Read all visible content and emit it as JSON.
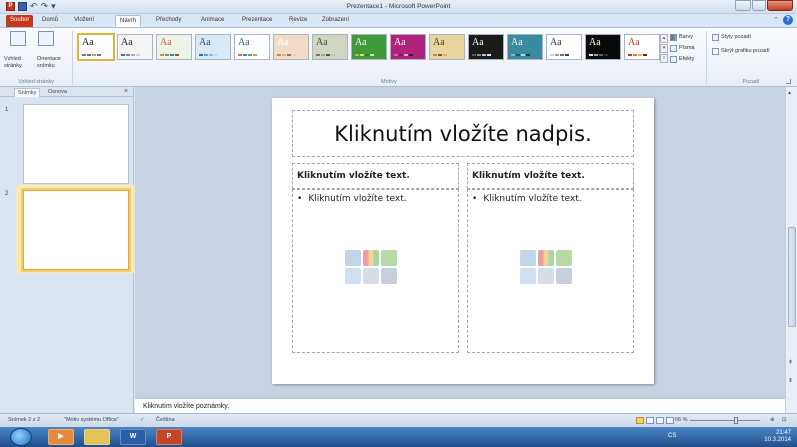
{
  "window": {
    "title": "Prezentace1 - Microsoft PowerPoint",
    "qat_app": "P"
  },
  "tabs": {
    "file": "Soubor",
    "items": [
      "Domů",
      "Vložení",
      "Návrh",
      "Přechody",
      "Animace",
      "Prezentace",
      "Revize",
      "Zobrazení"
    ],
    "active": "Návrh"
  },
  "ribbon": {
    "page_setup": {
      "layout_label": "Vzhled stránky",
      "orientation_label": "Orientace snímku",
      "group_label": "Vzhled stránky"
    },
    "themes": {
      "group_label": "Motivy",
      "items": [
        {
          "label": "Aa",
          "bg": "#ffffff",
          "fg": "#222222",
          "bars": [
            "#4f81bd",
            "#c0504d",
            "#9bbb59",
            "#8064a2"
          ],
          "selected": true
        },
        {
          "label": "Aa",
          "bg": "#f4f4f4",
          "fg": "#222222",
          "bars": [
            "#5c6b7a",
            "#7a8a9b",
            "#a3b1c0",
            "#ccd4dd"
          ],
          "selected": false
        },
        {
          "label": "Aa",
          "bg": "#eef3e8",
          "fg": "#c46a2a",
          "bars": [
            "#d5893a",
            "#7a9a3a",
            "#4a7aa0",
            "#a04a4a"
          ],
          "selected": false
        },
        {
          "label": "Aa",
          "bg": "#dbe9f6",
          "fg": "#1f4f8c",
          "bars": [
            "#2f6db1",
            "#5aa0d8",
            "#89c0e8",
            "#c3dcf0"
          ],
          "selected": false
        },
        {
          "label": "Aa",
          "bg": "#ffffff",
          "fg": "#2a5d8a",
          "bars": [
            "#e06a2a",
            "#2a8ad0",
            "#6aa83a",
            "#d0a02a"
          ],
          "selected": false
        },
        {
          "label": "Aa",
          "bg": "#f3dcc6",
          "fg": "#ffffff",
          "bars": [
            "#d08a5a",
            "#e0b08a",
            "#b06a3a",
            "#f0d0b0"
          ],
          "selected": false
        },
        {
          "label": "Aa",
          "bg": "#cfd6c4",
          "fg": "#3a4a2a",
          "bars": [
            "#6a7a4a",
            "#9aa87a",
            "#4a5a3a",
            "#c0c8aa"
          ],
          "selected": false
        },
        {
          "label": "Aa",
          "bg": "#3f9a3a",
          "fg": "#ffffff",
          "bars": [
            "#9ac83a",
            "#e8e03a",
            "#3a7a2a",
            "#d0e8a0"
          ],
          "selected": false
        },
        {
          "label": "Aa",
          "bg": "#b0237a",
          "fg": "#ffffff",
          "bars": [
            "#e05aa8",
            "#7a1a5a",
            "#f0a0d0",
            "#4a0a3a"
          ],
          "selected": false
        },
        {
          "label": "Aa",
          "bg": "#e8d6a2",
          "fg": "#5a3a0a",
          "bars": [
            "#c08a2a",
            "#8a5a1a",
            "#e0b060",
            "#f0d8a0"
          ],
          "selected": false
        },
        {
          "label": "Aa",
          "bg": "#1a1a1a",
          "fg": "#ffffff",
          "bars": [
            "#5a5a5a",
            "#8a8a8a",
            "#c0c0c0",
            "#e0e0e0"
          ],
          "selected": false
        },
        {
          "label": "Aa",
          "bg": "#3a8aa0",
          "fg": "#ffffff",
          "bars": [
            "#6ac0d0",
            "#1a5a70",
            "#a0e0e8",
            "#0a3a4a"
          ],
          "selected": false
        },
        {
          "label": "Aa",
          "bg": "#ffffff",
          "fg": "#333333",
          "bars": [
            "#d0d0d0",
            "#a0a0a0",
            "#707070",
            "#404040"
          ],
          "selected": false
        },
        {
          "label": "Aa",
          "bg": "#0a0a0a",
          "fg": "#ffffff",
          "bars": [
            "#e0e0e0",
            "#a0a0a0",
            "#606060",
            "#303030"
          ],
          "selected": false
        },
        {
          "label": "Aa",
          "bg": "#ffffff",
          "fg": "#c8382a",
          "bars": [
            "#c8382a",
            "#e07a3a",
            "#f0b04a",
            "#7a1a1a"
          ],
          "selected": false
        }
      ],
      "colors_label": "Barvy",
      "fonts_label": "Písma",
      "effects_label": "Efekty"
    },
    "background": {
      "styles_label": "Styly pozadí",
      "hide_label": "Skrýt grafiku pozadí",
      "group_label": "Pozadí"
    }
  },
  "slides_panel": {
    "tab_slides": "Snímky",
    "tab_outline": "Osnova",
    "slides": [
      {
        "number": "1",
        "selected": false
      },
      {
        "number": "2",
        "selected": true
      }
    ]
  },
  "slide": {
    "title_placeholder": "Kliknutím vložíte nadpis.",
    "left": {
      "header": "Kliknutím vložíte text.",
      "bullet": "Kliknutím vložíte text."
    },
    "right": {
      "header": "Kliknutím vložíte text.",
      "bullet": "Kliknutím vložíte text."
    }
  },
  "notes": {
    "placeholder": "Kliknutím vložíte poznámky."
  },
  "statusbar": {
    "slide_counter": "Snímek 2 z 2",
    "theme_name": "\"Motiv systému Office\"",
    "language": "Čeština",
    "zoom": "66 %"
  },
  "taskbar": {
    "apps": [
      "W",
      "P"
    ],
    "lang": "CS",
    "time": "21:47",
    "date": "10.3.2014"
  }
}
